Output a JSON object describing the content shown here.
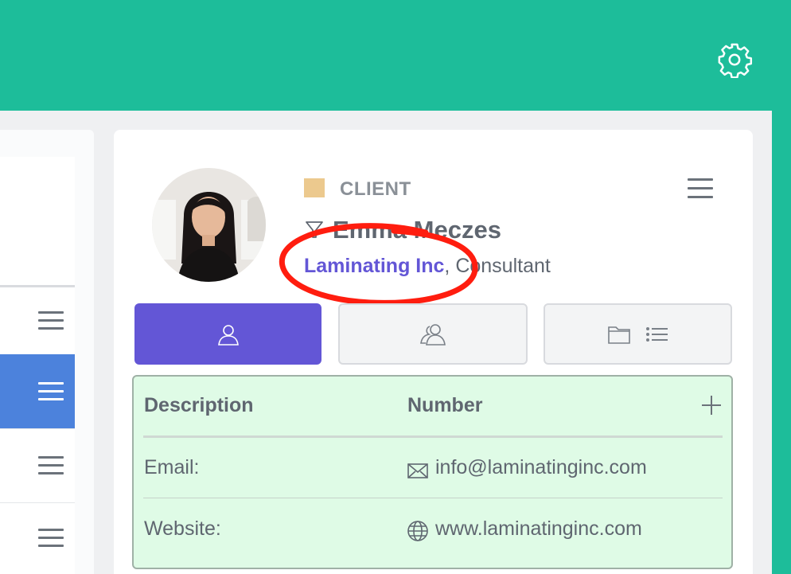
{
  "header": {
    "settings_icon": "gear-icon",
    "color": "#1dbd9a"
  },
  "left_panel": {
    "rows": [
      {
        "icon": "hamburger-menu-icon",
        "active": false
      },
      {
        "icon": "hamburger-menu-icon",
        "active": true
      },
      {
        "icon": "hamburger-menu-icon",
        "active": false
      },
      {
        "icon": "hamburger-menu-icon",
        "active": false
      }
    ]
  },
  "contact": {
    "type_label": "CLIENT",
    "type_color": "#ecc98e",
    "name": "Emma Meczes",
    "company": "Laminating Inc",
    "separator": ", ",
    "role": "Consultant"
  },
  "tabs": [
    {
      "icon": "person-icon",
      "active": true
    },
    {
      "icon": "people-icon",
      "active": false
    },
    {
      "icon": "folder-list-icon",
      "active": false
    }
  ],
  "details": {
    "columns": [
      "Description",
      "Number"
    ],
    "rows": [
      {
        "label": "Email:",
        "icon": "envelope-icon",
        "value": "info@laminatinginc.com"
      },
      {
        "label": "Website:",
        "icon": "globe-icon",
        "value": "www.laminatinginc.com"
      }
    ]
  },
  "colors": {
    "accent": "#6356d6",
    "active_row": "#4c82dc",
    "details_bg": "#dffbe6",
    "annotation": "#ff1d0f"
  }
}
